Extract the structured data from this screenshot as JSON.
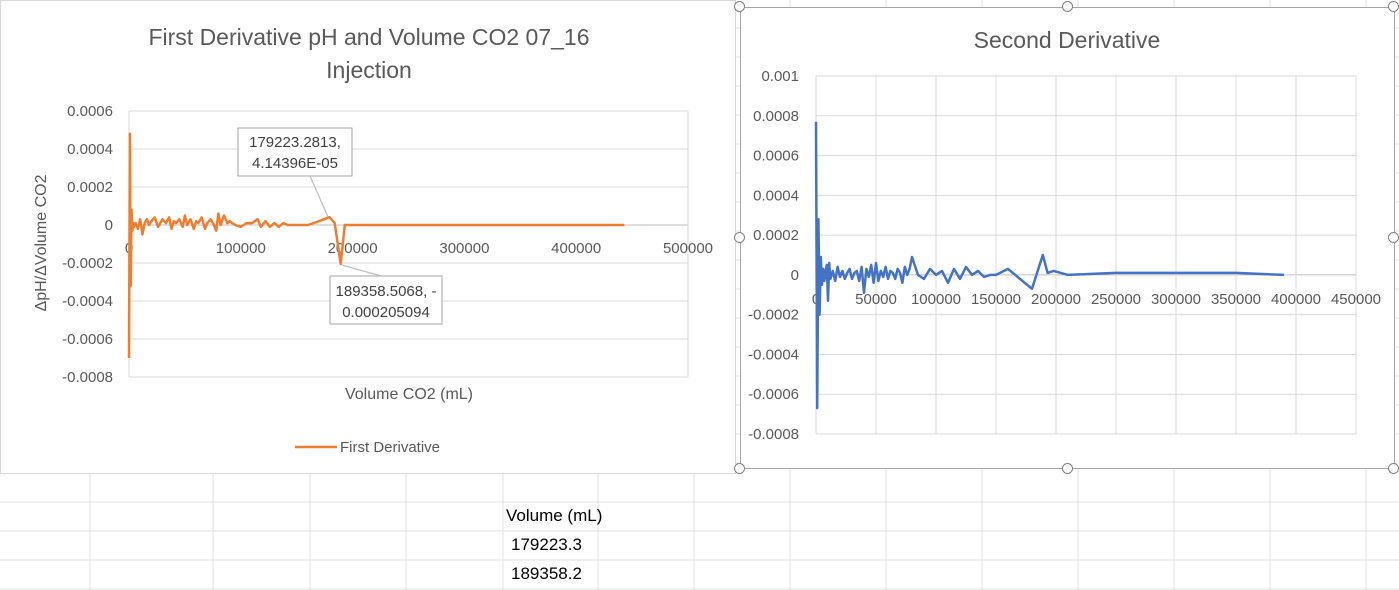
{
  "sheet": {
    "table": {
      "header": "Volume (mL)",
      "rows": [
        "179223.3",
        "189358.2"
      ]
    }
  },
  "chart_data": [
    {
      "type": "line",
      "title_line1": "First Derivative pH and Volume CO2 07_16",
      "title_line2": "Injection",
      "xlabel": "Volume CO2 (mL)",
      "ylabel": "ΔpH/ΔVolume CO2",
      "xlim": [
        0,
        500000
      ],
      "ylim": [
        -0.0008,
        0.0006
      ],
      "xticks": [
        "0",
        "100000",
        "200000",
        "300000",
        "400000",
        "500000"
      ],
      "yticks": [
        "0.0006",
        "0.0004",
        "0.0002",
        "0",
        "-0.0002",
        "-0.0004",
        "-0.0006",
        "-0.0008"
      ],
      "grid": true,
      "legend_position": "bottom",
      "color": "#ED7D31",
      "series": [
        {
          "name": "First Derivative",
          "x": [
            0,
            800,
            1500,
            2200,
            3000,
            3800,
            4500,
            6000,
            8000,
            10000,
            12000,
            14000,
            16000,
            18000,
            20000,
            23000,
            26000,
            30000,
            33000,
            36000,
            38000,
            40000,
            42000,
            45000,
            48000,
            50000,
            52000,
            55000,
            58000,
            60000,
            62000,
            65000,
            68000,
            70000,
            73000,
            76000,
            78000,
            80000,
            82000,
            85000,
            88000,
            90000,
            95000,
            100000,
            105000,
            110000,
            115000,
            118000,
            122000,
            126000,
            130000,
            134000,
            138000,
            142000,
            150000,
            160000,
            170000,
            179223.2813,
            184000,
            189358.5068,
            193000,
            200000,
            220000,
            250000,
            300000,
            350000,
            400000,
            443000
          ],
          "y": [
            -0.0007,
            0.00048,
            -0.00032,
            8e-05,
            -3e-05,
            1e-05,
            -1e-05,
            1e-05,
            -2e-05,
            3e-05,
            -5e-05,
            1e-05,
            3e-05,
            0.0,
            2e-05,
            4e-05,
            -1e-05,
            3e-05,
            1e-05,
            4e-05,
            -2e-05,
            2e-05,
            1e-05,
            3e-05,
            -1e-05,
            5e-05,
            0.0,
            3e-05,
            -2e-05,
            2e-05,
            1e-05,
            4e-05,
            -2e-05,
            1e-05,
            3e-05,
            0.0,
            -3e-05,
            6e-05,
            0.0,
            5e-05,
            1e-05,
            2e-05,
            0.0,
            -1e-05,
            1e-05,
            1e-05,
            3e-05,
            -1e-05,
            2e-05,
            -1e-05,
            1e-05,
            -1e-05,
            1e-05,
            0.0,
            0.0,
            0.0,
            2e-05,
            4.14396e-05,
            1e-05,
            -0.000205094,
            0.0,
            0.0,
            0.0,
            0.0,
            0.0,
            0.0,
            0.0,
            0.0
          ]
        }
      ],
      "annotations": [
        {
          "line1": "179223.2813,",
          "line2": "4.14396E-05",
          "x": 179223.2813,
          "y": 4.14396e-05
        },
        {
          "line1": "189358.5068, -",
          "line2": "0.000205094",
          "x": 189358.5068,
          "y": -0.000205094
        }
      ]
    },
    {
      "type": "line",
      "title": "Second Derivative",
      "xlim": [
        0,
        450000
      ],
      "ylim": [
        -0.0008,
        0.001
      ],
      "xticks": [
        "0",
        "50000",
        "100000",
        "150000",
        "200000",
        "250000",
        "300000",
        "350000",
        "400000",
        "450000"
      ],
      "yticks": [
        "0.001",
        "0.0008",
        "0.0006",
        "0.0004",
        "0.0002",
        "0",
        "-0.0002",
        "-0.0004",
        "-0.0006",
        "-0.0008"
      ],
      "grid": true,
      "color": "#4472C4",
      "series": [
        {
          "x": [
            0,
            1000,
            2000,
            3000,
            4000,
            5000,
            6000,
            7000,
            8000,
            9000,
            10000,
            11000,
            12000,
            14000,
            16000,
            18000,
            20000,
            22000,
            24000,
            26000,
            28000,
            30000,
            32000,
            34000,
            36000,
            38000,
            40000,
            42000,
            44000,
            46000,
            48000,
            50000,
            52000,
            54000,
            56000,
            58000,
            60000,
            62000,
            64000,
            66000,
            68000,
            70000,
            72000,
            74000,
            76000,
            78000,
            80000,
            85000,
            90000,
            95000,
            100000,
            105000,
            110000,
            115000,
            120000,
            125000,
            130000,
            135000,
            140000,
            145000,
            150000,
            160000,
            170000,
            180000,
            189000,
            193000,
            198000,
            210000,
            250000,
            300000,
            350000,
            390000
          ],
          "y": [
            0.00077,
            -0.00067,
            0.00028,
            -0.0002,
            9e-05,
            -5e-05,
            3e-05,
            -3e-05,
            2e-05,
            5e-05,
            -0.00013,
            6e-05,
            -2e-05,
            2e-05,
            -3e-05,
            4e-05,
            -1e-05,
            2e-05,
            -2e-05,
            1e-05,
            3e-05,
            -2e-05,
            1e-05,
            2e-05,
            -3e-05,
            4e-05,
            -9e-05,
            3e-05,
            -1e-05,
            5e-05,
            -4e-05,
            6e-05,
            -3e-05,
            2e-05,
            -1e-05,
            4e-05,
            -2e-05,
            2e-05,
            1e-05,
            -2e-05,
            3e-05,
            1e-05,
            -4e-05,
            4e-05,
            0.0,
            3e-05,
            9e-05,
            0.0,
            -2e-05,
            3e-05,
            0.0,
            2e-05,
            -4e-05,
            3e-05,
            -2e-05,
            4e-05,
            0.0,
            2e-05,
            -1e-05,
            0.0,
            0.0,
            3e-05,
            -2e-05,
            -7e-05,
            0.0001,
            1e-05,
            2e-05,
            0.0,
            1e-05,
            1e-05,
            1e-05,
            0.0
          ]
        }
      ]
    }
  ]
}
